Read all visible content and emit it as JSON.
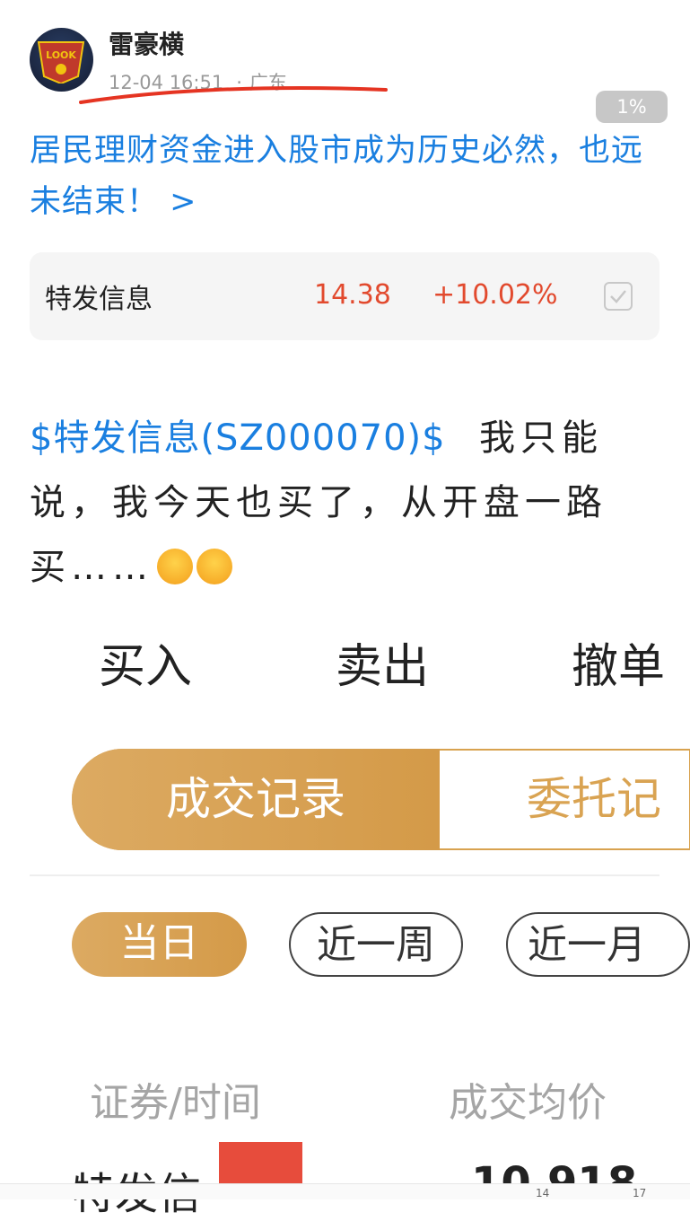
{
  "author": {
    "name": "雷豪横",
    "time": "12-04 16:51",
    "location": "广东",
    "avatar_text": "LOOK"
  },
  "progress_badge": "1%",
  "headline": "居民理财资金进入股市成为历史必然，也远未结束！ >",
  "stock": {
    "name": "特发信息",
    "price": "14.38",
    "change": "+10.02%",
    "accent": "#e24a2e"
  },
  "post": {
    "link": "$特发信息(SZ000070)$",
    "text": "我只能说，我今天也买了，从开盘一路买……"
  },
  "trade_tabs": [
    "买入",
    "卖出",
    "撤单"
  ],
  "segment": {
    "active": "成交记录",
    "inactive": "委托记"
  },
  "periods": [
    "当日",
    "近一周",
    "近一月"
  ],
  "table": {
    "headers": [
      "证券/时间",
      "成交均价"
    ],
    "cut_row_left": "特发信",
    "cut_row_right": "10.918"
  },
  "colors": {
    "link": "#1a7fe0",
    "gold": "#d49a48",
    "red": "#e74c3c"
  },
  "bottom_numbers": [
    "14",
    "17"
  ]
}
